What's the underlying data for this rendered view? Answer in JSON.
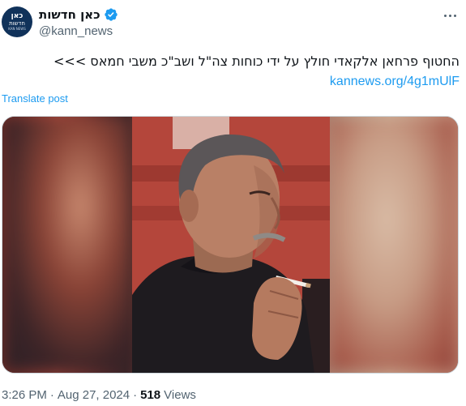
{
  "account": {
    "avatar_text": {
      "line1": "כאן",
      "line2": "חדשות",
      "line3": "KAN NEWS"
    },
    "display_name": "כאן חדשות",
    "handle": "@kann_news",
    "verified_icon": "verified-badge-icon",
    "verified_color": "#1d9bf0"
  },
  "menu": {
    "more_icon": "more-options-icon"
  },
  "post": {
    "text": "החטוף פרחאן אלקאדי חולץ על ידי כוחות צה\"ל ושב\"כ משבי חמאס >>>",
    "link": "kannews.org/4g1mUlF",
    "translate_label": "Translate post",
    "link_color": "#1d9bf0"
  },
  "media": {
    "description_icon": "photo-image"
  },
  "footer": {
    "time": "3:26 PM",
    "separator1": "·",
    "date": "Aug 27, 2024",
    "separator2": "·",
    "views_count": "518",
    "views_label": "Views"
  }
}
